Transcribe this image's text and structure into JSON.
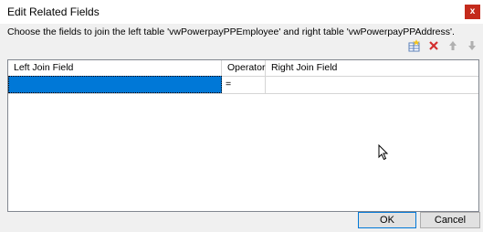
{
  "window": {
    "title": "Edit Related Fields",
    "close_label": "x"
  },
  "instruction": "Choose the fields to join the left table 'vwPowerpayPPEmployee' and right table 'vwPowerpayPPAddress'.",
  "toolbar": {
    "icons": [
      "add-row-icon",
      "delete-icon",
      "move-up-icon",
      "move-down-icon"
    ],
    "delete_color": "#d32f2f"
  },
  "grid": {
    "columns": [
      "Left Join Field",
      "Operator",
      "Right Join Field"
    ],
    "rows": [
      {
        "left": "",
        "operator": "=",
        "right": ""
      }
    ],
    "selection_color": "#0078d7"
  },
  "buttons": {
    "ok": "OK",
    "cancel": "Cancel"
  }
}
